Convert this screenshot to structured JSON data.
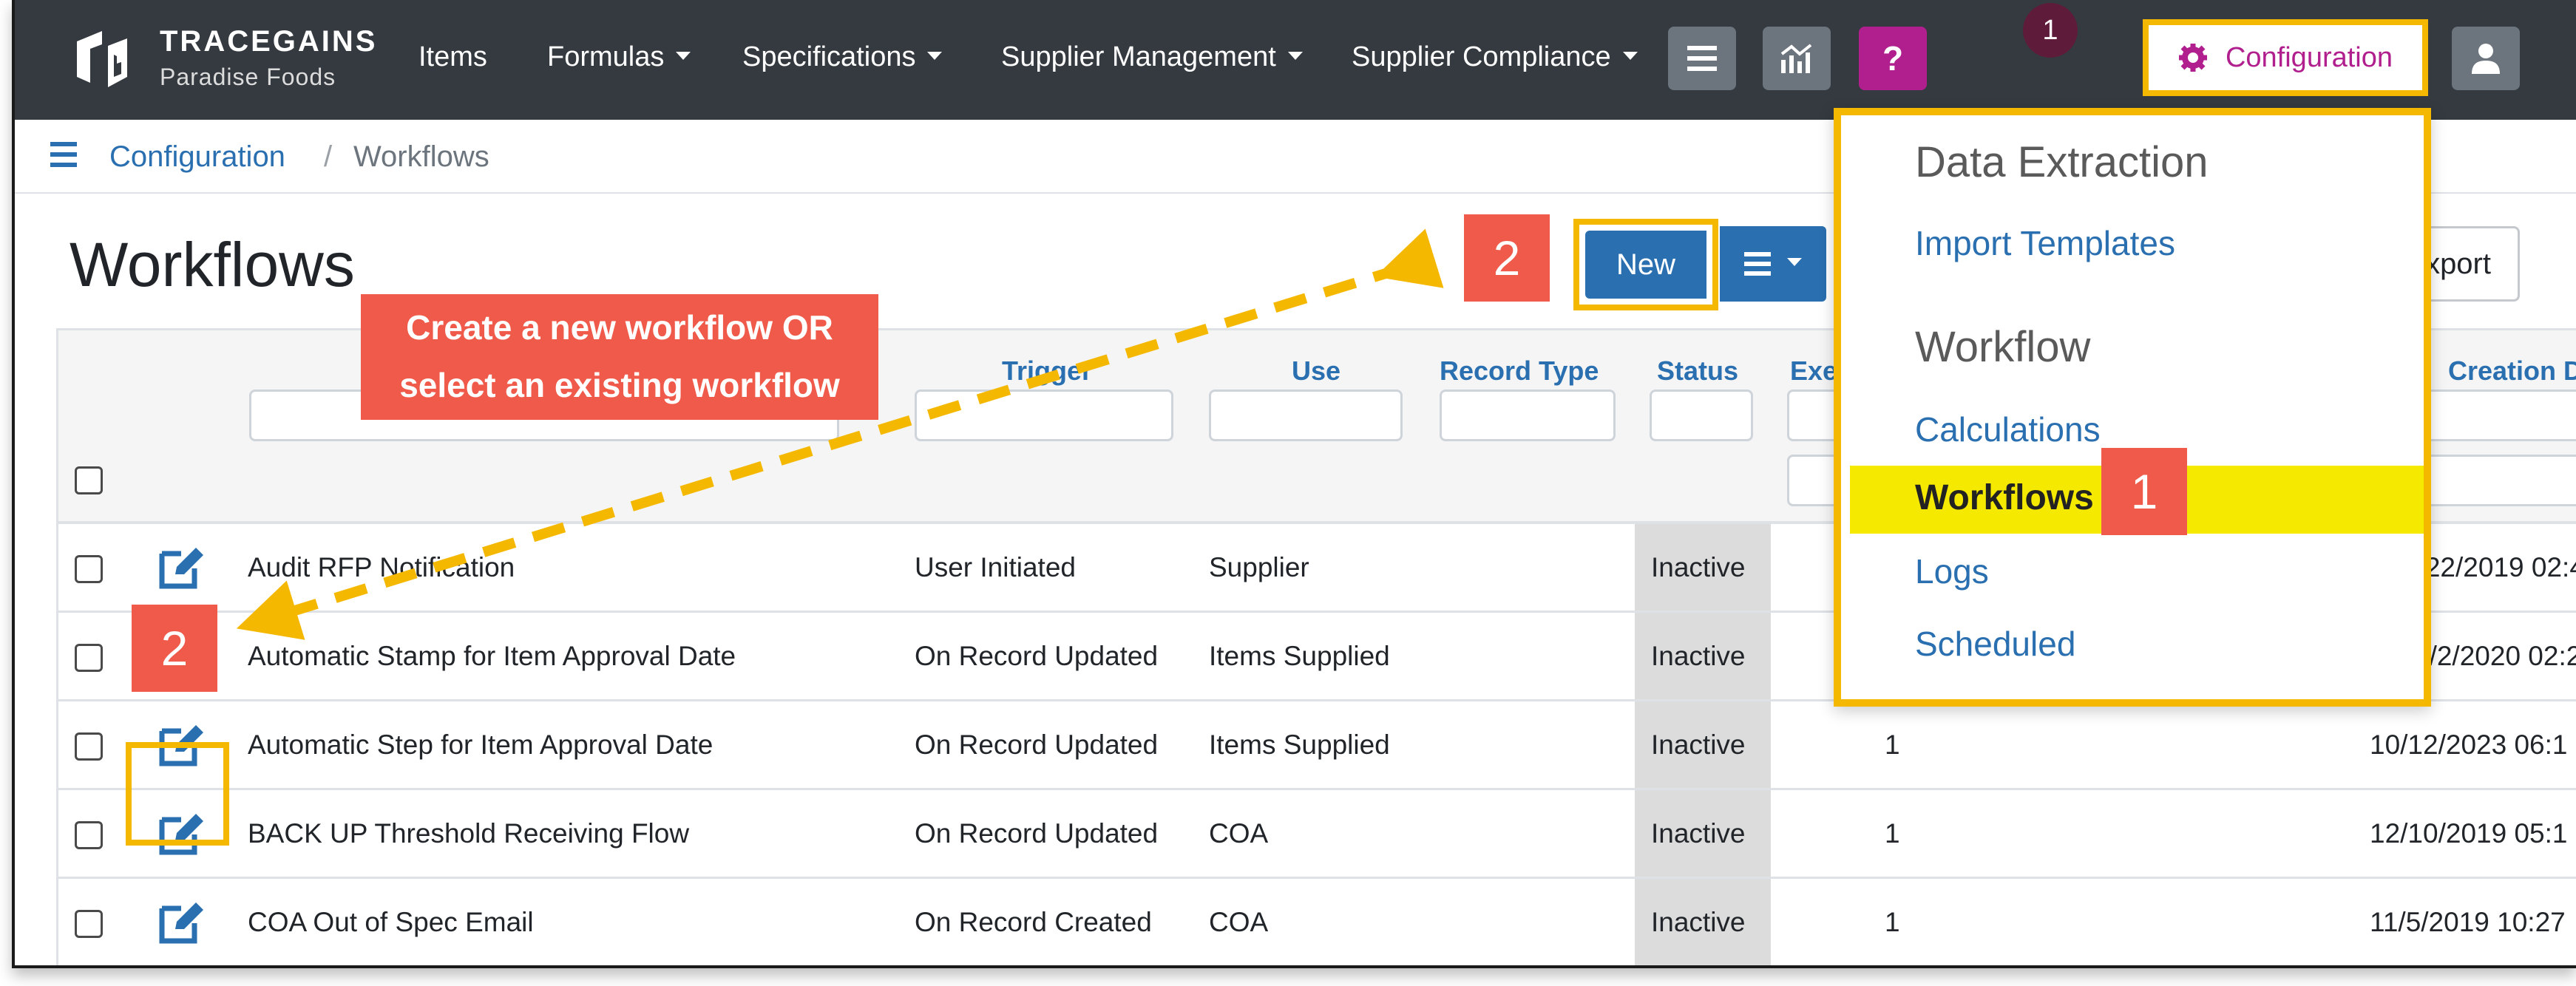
{
  "brand": {
    "name": "TRACEGAINS",
    "sub": "Paradise Foods"
  },
  "nav": {
    "items": [
      "Items",
      "Formulas",
      "Specifications",
      "Supplier Management",
      "Supplier Compliance"
    ],
    "notif_count": "1",
    "config_label": "Configuration"
  },
  "breadcrumb": {
    "parent": "Configuration",
    "sep": "/",
    "current": "Workflows"
  },
  "page": {
    "title": "Workflows"
  },
  "toolbar": {
    "new_label": "New",
    "export_label": "xport"
  },
  "table": {
    "headers": {
      "trigger": "Trigger",
      "use": "Use",
      "record_type": "Record Type",
      "status": "Status",
      "exec": "Exe",
      "creation": "Creation D"
    },
    "rows": [
      {
        "name": "Audit RFP Notification",
        "trigger": "User Initiated",
        "use": "Supplier",
        "status": "Inactive",
        "exec": "",
        "created": "1/22/2019 02:4"
      },
      {
        "name": "Automatic Stamp for Item Approval Date",
        "trigger": "On Record Updated",
        "use": "Items Supplied",
        "status": "Inactive",
        "exec": "",
        "created": "1/2/2020 02:2"
      },
      {
        "name": "Automatic Step for Item Approval Date",
        "trigger": "On Record Updated",
        "use": "Items Supplied",
        "status": "Inactive",
        "exec": "1",
        "created": "10/12/2023 06:1"
      },
      {
        "name": "BACK UP Threshold Receiving Flow",
        "trigger": "On Record Updated",
        "use": "COA",
        "status": "Inactive",
        "exec": "1",
        "created": "12/10/2019 05:1"
      },
      {
        "name": "COA Out of Spec Email",
        "trigger": "On Record Created",
        "use": "COA",
        "status": "Inactive",
        "exec": "1",
        "created": "11/5/2019 10:27"
      }
    ]
  },
  "dropdown": {
    "section1": "Data Extraction",
    "import_templates": "Import Templates",
    "section2": "Workflow",
    "calculations": "Calculations",
    "workflows": "Workflows",
    "logs": "Logs",
    "scheduled": "Scheduled"
  },
  "callouts": {
    "step1": "1",
    "step2": "2",
    "text_line1": "Create a new workflow OR",
    "text_line2": "select an existing workflow"
  },
  "colors": {
    "navbar": "#343a40",
    "link": "#2a6fb0",
    "highlight": "#f5b800",
    "callout": "#ef5a4a",
    "menu_active": "#f5e900",
    "config": "#b11f8e"
  }
}
